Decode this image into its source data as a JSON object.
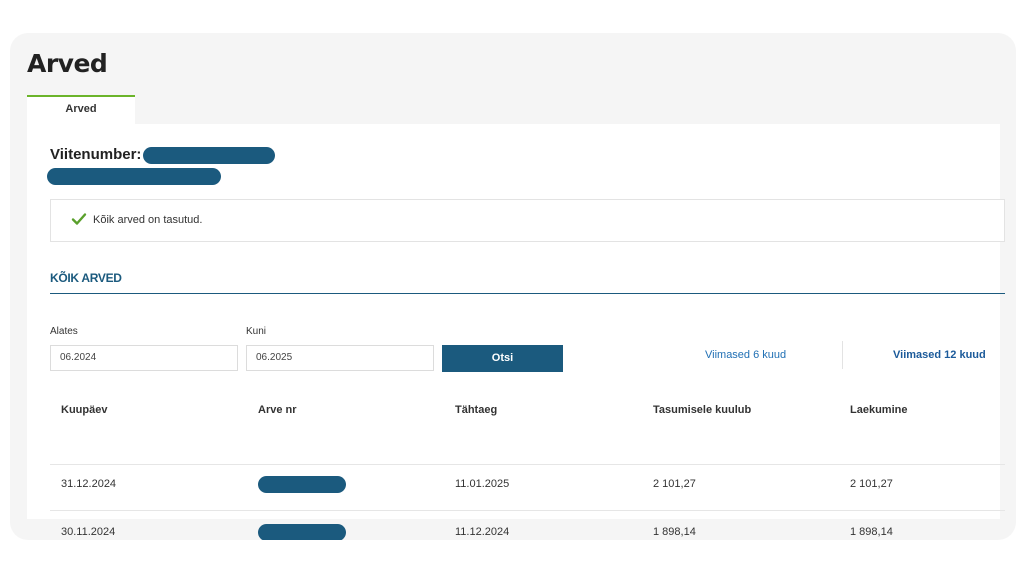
{
  "page": {
    "title": "Arved"
  },
  "tabs": [
    {
      "label": "Arved",
      "active": true
    }
  ],
  "reference": {
    "label": "Viitenumber:"
  },
  "status": {
    "message": "Kõik arved on tasutud.",
    "icon": "check-icon",
    "color": "#5aa02c"
  },
  "section": {
    "title": "KÕIK ARVED"
  },
  "filters": {
    "from": {
      "label": "Alates",
      "value": "06.2024"
    },
    "to": {
      "label": "Kuni",
      "value": "06.2025"
    },
    "search_label": "Otsi",
    "quick": [
      "Viimased 6 kuud",
      "Viimased 12 kuud"
    ]
  },
  "table": {
    "headers": [
      "Kuupäev",
      "Arve nr",
      "Tähtaeg",
      "Tasumisele kuulub",
      "Laekumine"
    ],
    "rows": [
      {
        "date": "31.12.2024",
        "due": "11.01.2025",
        "amount": "2 101,27",
        "received": "2 101,27"
      },
      {
        "date": "30.11.2024",
        "due": "11.12.2024",
        "amount": "1 898,14",
        "received": "1 898,14"
      }
    ]
  },
  "colors": {
    "accent": "#1b5a7e",
    "tab_active": "#6bb42a",
    "link": "#1f6fb4"
  }
}
